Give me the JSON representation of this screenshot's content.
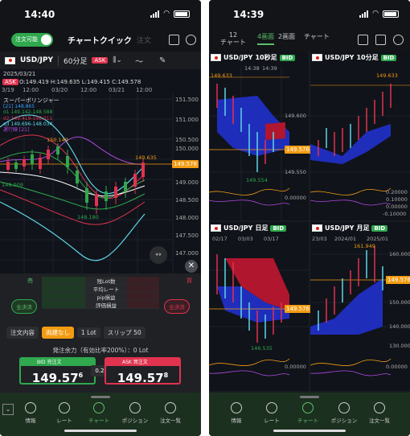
{
  "left": {
    "status": {
      "time": "14:40"
    },
    "toolbar": {
      "toggle_label": "注文可能",
      "title": "チャートクイック",
      "faded_label": "注文"
    },
    "symbol_row": {
      "symbol": "USD/JPY",
      "timeframe": "60分足",
      "ask_badge": "ASK"
    },
    "chart": {
      "date": "2025/03/21",
      "ask_tag": "ASK",
      "ohlc": "O:149.419  H:149.635  L:149.415  C:149.578",
      "indicator_title": "スーパーボリンジャー",
      "legend": [
        "[21] 148.865",
        "σ1 149.142-148.588",
        "σ2 149.419-148.311",
        "σ3 149.696-148.034",
        "遅行線 [21]"
      ],
      "x_labels": [
        "3/19",
        "12:00",
        "03/20",
        "12:00",
        "03/21",
        "12:00"
      ],
      "y_labels": [
        "151.500",
        "151.000",
        "150.500",
        "150.000",
        "149.578",
        "149.000",
        "148.500",
        "148.000",
        "147.500",
        "147.000"
      ],
      "annotations": {
        "high": "149.635",
        "mid_high": "150.149",
        "left_mid": "149.009",
        "low": "148.180"
      },
      "current_price": "149.578"
    },
    "order_panel": {
      "sell_label": "売",
      "buy_label": "買",
      "rows": [
        "残Lot数",
        "平均レート",
        "pip損益",
        "評価損益"
      ],
      "close_sell": "全決済",
      "close_buy": "全決済",
      "controls": [
        "注文内容",
        "両建なし",
        "1 Lot",
        "スリップ 50"
      ],
      "margin_text": "発注余力（有効比率200%）：0 Lot",
      "bid": {
        "label": "BID",
        "sub": "売注文",
        "price_main": "149.57",
        "price_sup": "6"
      },
      "ask": {
        "label": "ASK",
        "sub": "買注文",
        "price_main": "149.57",
        "price_sup": "8"
      },
      "spread": "0.2"
    },
    "nav": [
      "情報",
      "レート",
      "チャート",
      "ポジション",
      "注文一覧"
    ]
  },
  "right": {
    "status": {
      "time": "14:39"
    },
    "tabs": {
      "t1_top": "12",
      "t1_bottom": "チャート",
      "t2": "4画面",
      "t3": "2画面",
      "t4": "チャート"
    },
    "charts": [
      {
        "symbol": "USD/JPY",
        "tf": "10秒足",
        "badge": "BID",
        "x_labels": [
          "14:38",
          "14:39"
        ],
        "y_labels": [
          "149.600",
          "149.550"
        ],
        "high": "149.633",
        "low": "149.554",
        "price": "149.576",
        "sub_labels": []
      },
      {
        "symbol": "USD/JPY",
        "tf": "10分足",
        "badge": "BID",
        "x_labels": [],
        "y_labels": [],
        "high": "149.633",
        "low": "",
        "price": "",
        "sub_labels": [
          "0.20000",
          "0.10000",
          "0.00000",
          "-0.10000"
        ]
      },
      {
        "symbol": "USD/JPY",
        "tf": "日足",
        "badge": "BID",
        "x_labels": [
          "02/17",
          "03/03",
          "03/17"
        ],
        "y_labels": [],
        "high": "",
        "low": "146.535",
        "price": "149.576",
        "sub_labels": [
          "0.00000"
        ]
      },
      {
        "symbol": "USD/JPY",
        "tf": "月足",
        "badge": "BID",
        "x_labels": [
          "23/03",
          "2024/01",
          "2025/01"
        ],
        "y_labels": [
          "160.000",
          "150.000",
          "140.000",
          "130.000"
        ],
        "high": "161.949",
        "low": "",
        "price": "149.576",
        "sub_labels": [
          "0.00000"
        ]
      }
    ],
    "chart0_sub_label": "0.00000",
    "nav": [
      "情報",
      "レート",
      "チャート",
      "ポジション",
      "注文一覧"
    ]
  },
  "colors": {
    "bid_green": "#2fa84e",
    "ask_red": "#e0334f",
    "accent_orange": "#f39c12"
  }
}
